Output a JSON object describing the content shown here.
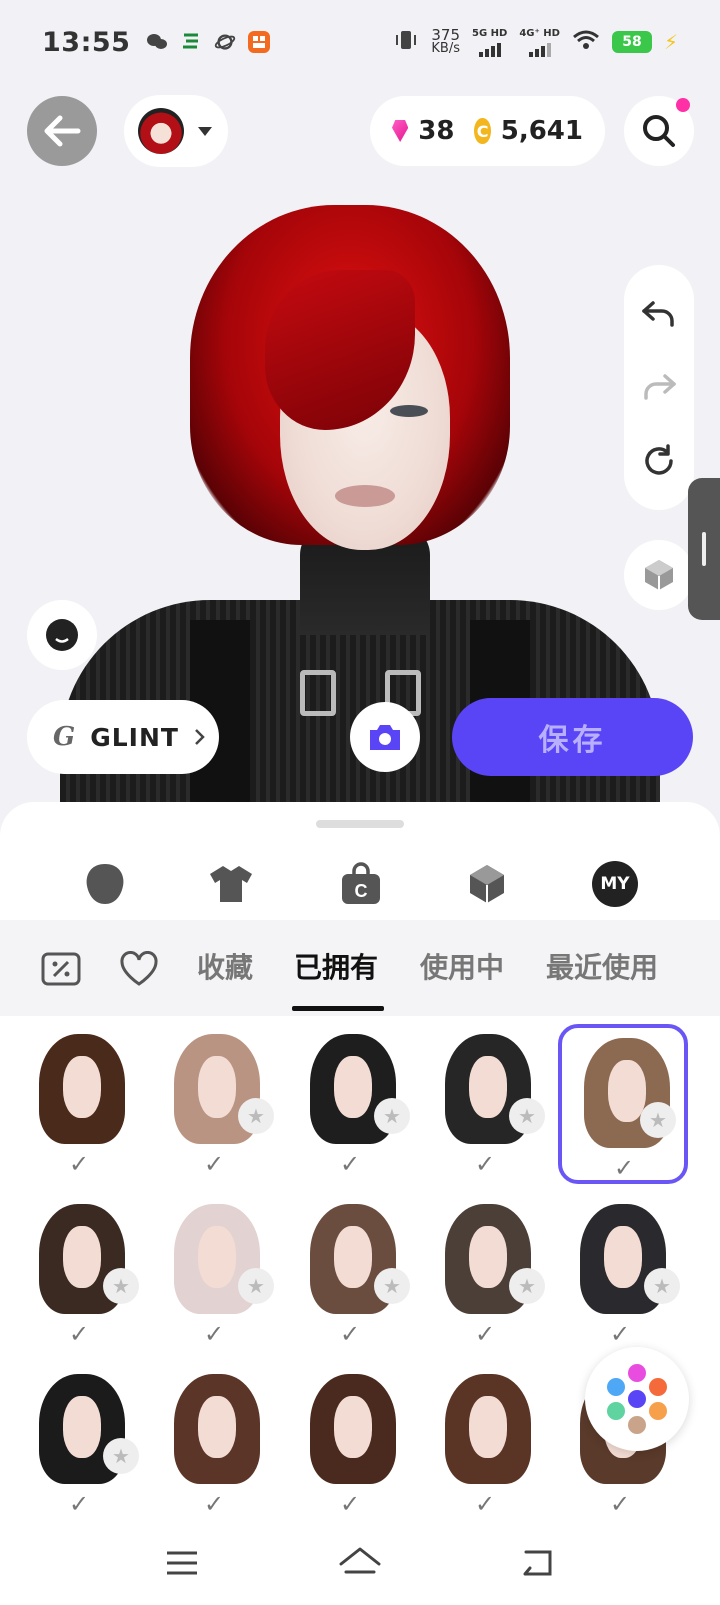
{
  "status_bar": {
    "time": "13:55",
    "net_speed_value": "375",
    "net_speed_unit": "KB/s",
    "sim1_label": "5G HD",
    "sim2_label": "4G⁺ HD",
    "battery": "58"
  },
  "header": {
    "gems": "38",
    "coins": "5,641"
  },
  "actions": {
    "brand_label": "GLINT",
    "save_label": "保存"
  },
  "categories": {
    "my_label": "MY"
  },
  "filters": {
    "favorites": "收藏",
    "owned": "已拥有",
    "in_use": "使用中",
    "recent": "最近使用"
  },
  "hair_items": [
    {
      "color": "#4a2a1a",
      "starred": false,
      "selected": false
    },
    {
      "color": "#b99482",
      "starred": true,
      "selected": false
    },
    {
      "color": "#1e1e1e",
      "starred": true,
      "selected": false
    },
    {
      "color": "#262626",
      "starred": true,
      "selected": false
    },
    {
      "color": "#8c6a52",
      "starred": true,
      "selected": true
    },
    {
      "color": "#3b2a22",
      "starred": true,
      "selected": false
    },
    {
      "color": "#e2d2d2",
      "starred": true,
      "selected": false
    },
    {
      "color": "#6a4d3e",
      "starred": true,
      "selected": false
    },
    {
      "color": "#4b3f37",
      "starred": true,
      "selected": false
    },
    {
      "color": "#2a2a2e",
      "starred": true,
      "selected": false
    },
    {
      "color": "#1b1b1b",
      "starred": true,
      "selected": false
    },
    {
      "color": "#5b3528",
      "starred": false,
      "selected": false
    },
    {
      "color": "#4a2a1e",
      "starred": false,
      "selected": false
    },
    {
      "color": "#5a3526",
      "starred": false,
      "selected": false
    },
    {
      "color": "#5a3a2a",
      "starred": false,
      "selected": false
    }
  ],
  "colors": {
    "accent": "#5a45f6",
    "selection_border": "#6a56f5",
    "notification": "#ff2fa6",
    "coin": "#f3b61f",
    "gem": "#e4168f"
  },
  "icons": {
    "back": "arrow-left-icon",
    "search": "search-icon",
    "undo": "undo-icon",
    "redo": "redo-icon",
    "reset": "reset-icon",
    "view3d": "cube-icon",
    "camera": "camera-icon",
    "face": "face-icon",
    "category_head": "head-icon",
    "category_clothes": "shirt-icon",
    "category_shop": "bag-icon",
    "category_3d": "cube-icon",
    "filter_discount": "discount-icon",
    "filter_like": "heart-icon",
    "palette": "palette-icon"
  }
}
